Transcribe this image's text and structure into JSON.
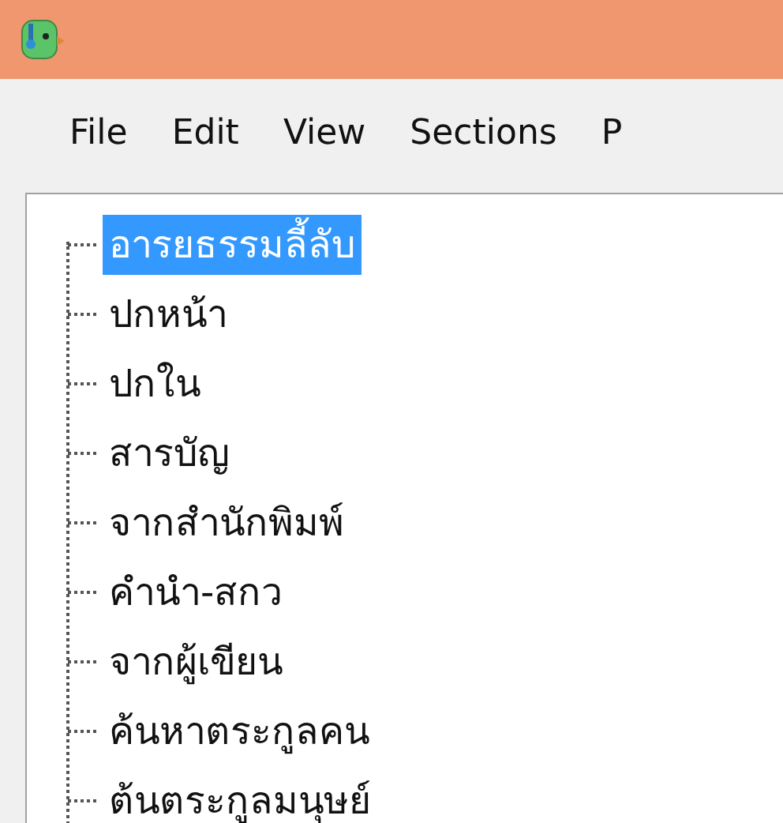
{
  "menu": [
    "File",
    "Edit",
    "View",
    "Sections",
    "P"
  ],
  "tree": [
    {
      "label": "อารยธรรมลี้ลับ",
      "selected": true
    },
    {
      "label": "ปกหน้า",
      "selected": false
    },
    {
      "label": "ปกใน",
      "selected": false
    },
    {
      "label": "สารบัญ",
      "selected": false
    },
    {
      "label": "จากสำนักพิมพ์",
      "selected": false
    },
    {
      "label": "คำนำ-สกว",
      "selected": false
    },
    {
      "label": "จากผู้เขียน",
      "selected": false
    },
    {
      "label": "ค้นหาตระกูลคน",
      "selected": false
    },
    {
      "label": "ต้นตระกูลมนุษย์",
      "selected": false
    }
  ]
}
